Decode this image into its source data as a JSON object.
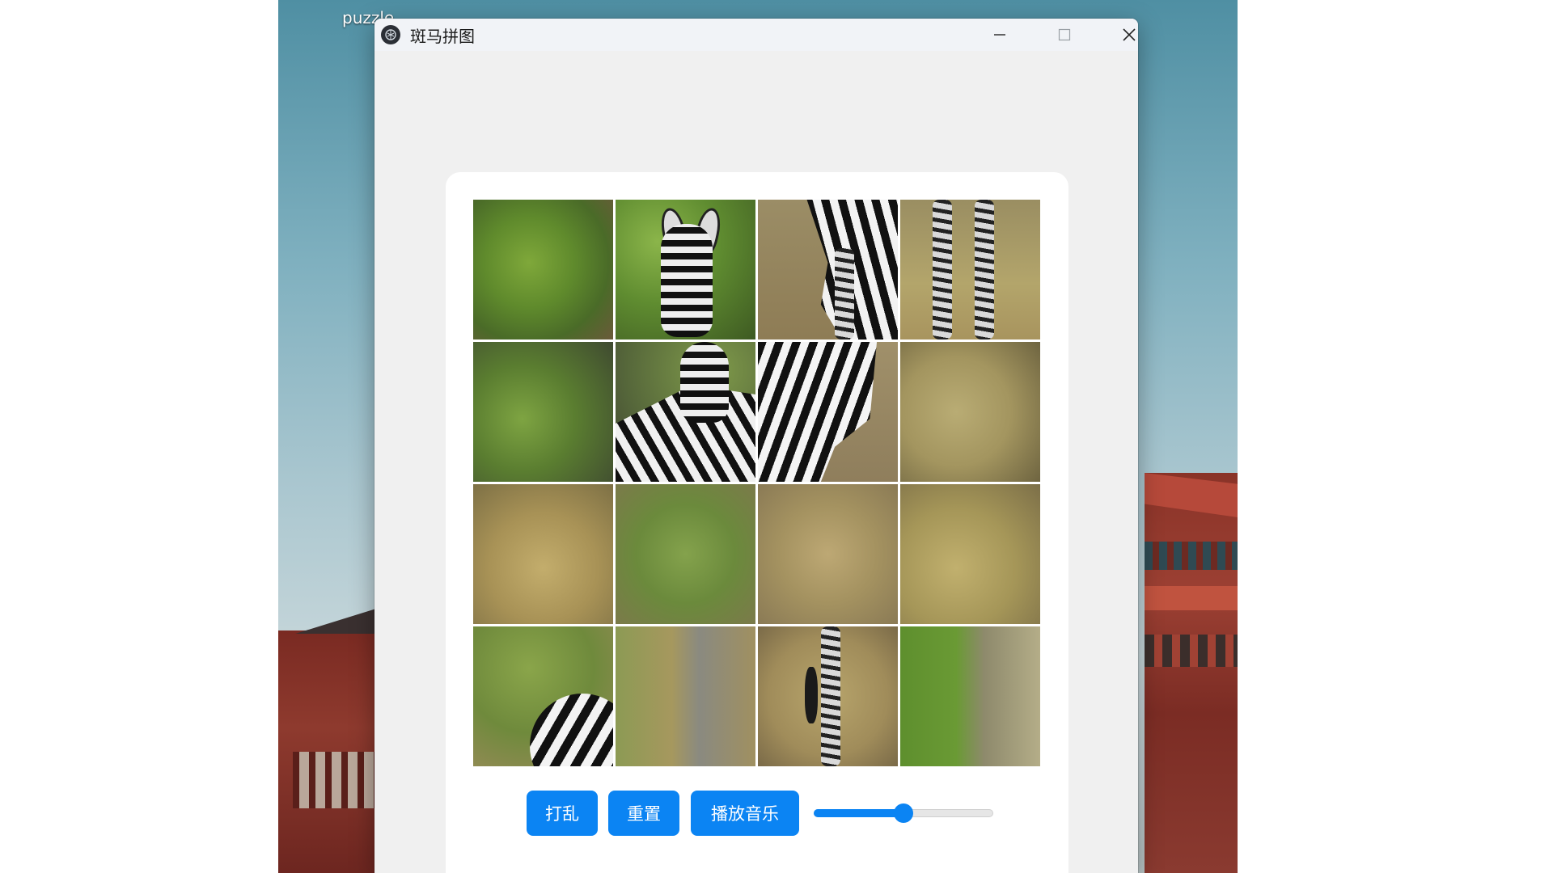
{
  "desktop": {
    "label": "puzzle"
  },
  "window": {
    "title": "斑马拼图",
    "controls": {
      "minimize": "minimize",
      "maximize": "maximize",
      "close": "close"
    }
  },
  "puzzle": {
    "grid_size": "4x4",
    "tiles": [
      {
        "id": 1,
        "content": "foliage"
      },
      {
        "id": 2,
        "content": "zebra-head"
      },
      {
        "id": 3,
        "content": "zebra-body"
      },
      {
        "id": 4,
        "content": "zebra-legs"
      },
      {
        "id": 5,
        "content": "foliage"
      },
      {
        "id": 6,
        "content": "zebra-neck"
      },
      {
        "id": 7,
        "content": "zebra-chest"
      },
      {
        "id": 8,
        "content": "grass"
      },
      {
        "id": 9,
        "content": "grass"
      },
      {
        "id": 10,
        "content": "foliage"
      },
      {
        "id": 11,
        "content": "grass"
      },
      {
        "id": 12,
        "content": "grass"
      },
      {
        "id": 13,
        "content": "zebra-rump"
      },
      {
        "id": 14,
        "content": "trees"
      },
      {
        "id": 15,
        "content": "zebra-tail"
      },
      {
        "id": 16,
        "content": "trees"
      }
    ]
  },
  "buttons": {
    "shuffle": "打乱",
    "reset": "重置",
    "play_music": "播放音乐"
  },
  "volume": {
    "value": 0.5
  },
  "colors": {
    "accent": "#0b84f3",
    "window_bg": "#f0f0f0",
    "card_bg": "#ffffff"
  }
}
